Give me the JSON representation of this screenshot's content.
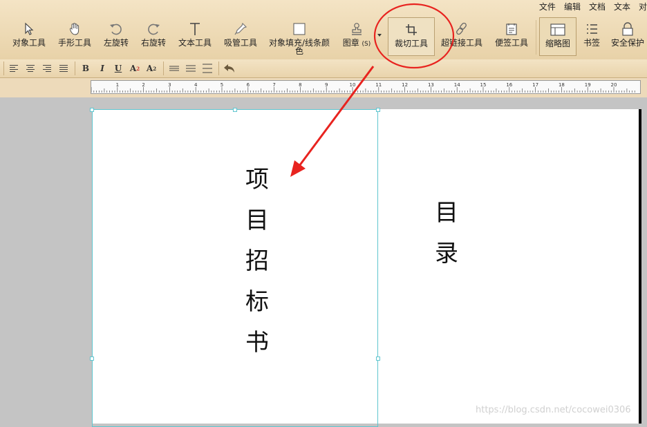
{
  "menu": [
    "文件",
    "编辑",
    "文档",
    "文本",
    "对"
  ],
  "tools": {
    "object": "对象工具",
    "hand": "手形工具",
    "rotate_left": "左旋转",
    "rotate_right": "右旋转",
    "text": "文本工具",
    "eyedropper": "吸管工具",
    "fill_line": "对象填充/线条颜色",
    "stamp": "图章",
    "stamp_key": "(S)",
    "crop": "裁切工具",
    "hyperlink": "超链接工具",
    "note": "便签工具",
    "thumbnail": "缩略图",
    "bookmark": "书签",
    "security": "安全保护"
  },
  "format": {
    "bold": "B",
    "italic": "I",
    "underline": "U",
    "superscript": "A",
    "sup_mark": "2",
    "subscript": "A",
    "sub_mark": "2"
  },
  "ruler": {
    "ticks": [
      "1",
      "2",
      "3",
      "4",
      "5",
      "6",
      "7",
      "8",
      "9",
      "10",
      "11",
      "12",
      "13",
      "14",
      "15",
      "16",
      "17",
      "18",
      "19",
      "20"
    ]
  },
  "document": {
    "left_title": [
      "项",
      "目",
      "招",
      "标",
      "书"
    ],
    "right_title": [
      "目",
      "录"
    ]
  },
  "watermark": "https://blog.csdn.net/cocowei0306",
  "colors": {
    "annotation": "#e8231f",
    "selection": "#5fc5cf"
  }
}
